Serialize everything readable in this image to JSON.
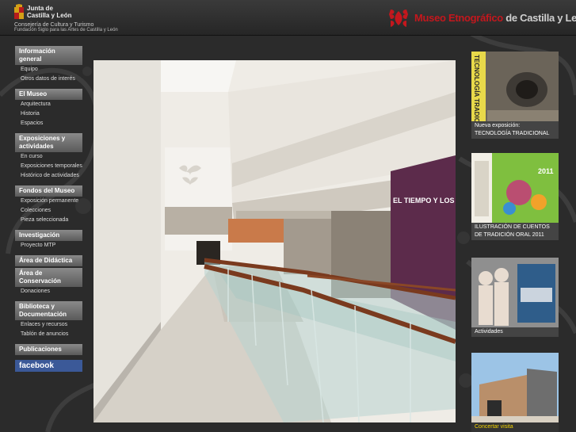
{
  "header": {
    "jcyl_line1": "Junta de",
    "jcyl_line2": "Castilla y León",
    "consejeria": "Consejería de Cultura y Turismo",
    "fundacion": "Fundación Siglo para las Artes de Castilla y León",
    "museum_title_red": "Museo Etnográfico",
    "museum_title_rest": " de Castilla y León"
  },
  "sidebar": {
    "sections": [
      {
        "head": "Información general",
        "items": [
          "Equipo",
          "Otros datos de interés"
        ]
      },
      {
        "head": "El Museo",
        "items": [
          "Arquitectura",
          "Historia",
          "Espacios"
        ]
      },
      {
        "head": "Exposiciones y actividades",
        "items": [
          "En curso",
          "Exposiciones temporales",
          "Histórico de actividades"
        ]
      },
      {
        "head": "Fondos del Museo",
        "items": [
          "Exposición permanente",
          "Colecciones",
          "Pieza seleccionada"
        ]
      },
      {
        "head": "Investigación",
        "items": [
          "Proyecto MTP"
        ]
      },
      {
        "head": "Área de Didáctica",
        "items": []
      },
      {
        "head": "Área de Conservación",
        "items": [
          "Donaciones"
        ]
      },
      {
        "head": "Biblioteca y Documentación",
        "items": [
          "Enlaces y recursos",
          "Tablón de anuncios"
        ]
      },
      {
        "head": "Publicaciones",
        "items": []
      }
    ],
    "facebook": "facebook"
  },
  "main": {
    "exhibit_sign": "EL TIEMPO Y LOS R"
  },
  "right": {
    "card1_caption_line1": "Nueva exposición:",
    "card1_caption_line2": "TECNOLOGÍA TRADICIONAL",
    "card1_thumb_text": "TECNOLOGÍA TRADICIONAL",
    "card2_caption_line1": "ILUSTRACIÓN DE CUENTOS",
    "card2_caption_line2": "DE TRADICIÓN ORAL 2011",
    "card2_thumb_text": "2011",
    "card3_caption": "Actividades",
    "card4_caption": "Concertar visita"
  },
  "colors": {
    "brand_red": "#c4171d",
    "background": "#2b2b2b",
    "nav_gray": "#6f6f6f",
    "caption_yellow": "#f4d400"
  }
}
